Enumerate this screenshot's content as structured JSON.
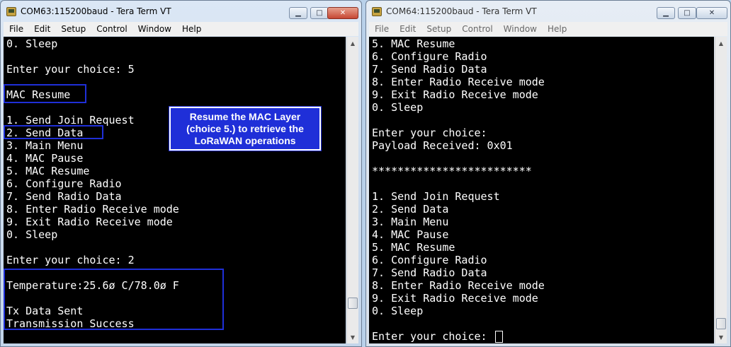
{
  "left_window": {
    "title": "COM63:115200baud - Tera Term VT",
    "menu": [
      "File",
      "Edit",
      "Setup",
      "Control",
      "Window",
      "Help"
    ],
    "lines": [
      "0. Sleep",
      "",
      "Enter your choice: 5",
      "",
      "MAC Resume",
      "",
      "1. Send Join Request",
      "2. Send Data",
      "3. Main Menu",
      "4. MAC Pause",
      "5. MAC Resume",
      "6. Configure Radio",
      "7. Send Radio Data",
      "8. Enter Radio Receive mode",
      "9. Exit Radio Receive mode",
      "0. Sleep",
      "",
      "Enter your choice: 2",
      "",
      "Temperature:25.6ø C/78.0ø F",
      "",
      "Tx Data Sent",
      "Transmission Success"
    ]
  },
  "right_window": {
    "title": "COM64:115200baud - Tera Term VT",
    "menu": [
      "File",
      "Edit",
      "Setup",
      "Control",
      "Window",
      "Help"
    ],
    "lines": [
      "5. MAC Resume",
      "6. Configure Radio",
      "7. Send Radio Data",
      "8. Enter Radio Receive mode",
      "9. Exit Radio Receive mode",
      "0. Sleep",
      "",
      "Enter your choice:",
      "Payload Received: 0x01",
      "",
      "*************************",
      "",
      "1. Send Join Request",
      "2. Send Data",
      "3. Main Menu",
      "4. MAC Pause",
      "5. MAC Resume",
      "6. Configure Radio",
      "7. Send Radio Data",
      "8. Enter Radio Receive mode",
      "9. Exit Radio Receive mode",
      "0. Sleep",
      "",
      "Enter your choice: "
    ]
  },
  "window_controls": {
    "minimize": "▁",
    "maximize": "□",
    "close": "✕"
  },
  "callout": {
    "lines": [
      "Resume the MAC Layer",
      "(choice 5.) to retrieve the",
      "LoRaWAN operations"
    ]
  },
  "colors": {
    "highlight": "#1f2fd8",
    "terminal_bg": "#000000",
    "terminal_fg": "#ffffff"
  }
}
